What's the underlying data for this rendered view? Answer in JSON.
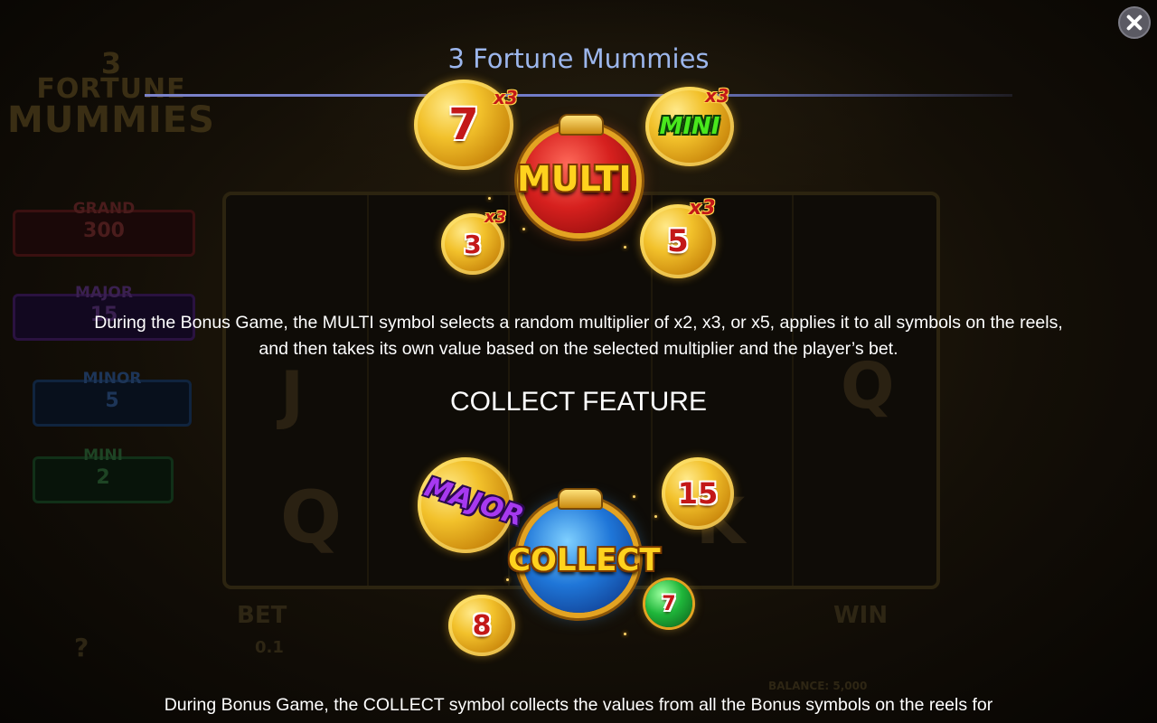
{
  "window": {
    "title": "3 Fortune Mummies"
  },
  "background": {
    "logo_lines": [
      "3",
      "FORTUNE",
      "MUMMIES"
    ],
    "jackpots": [
      {
        "label": "GRAND",
        "value": "300"
      },
      {
        "label": "MAJOR",
        "value": "15"
      },
      {
        "label": "MINOR",
        "value": "5"
      },
      {
        "label": "MINI",
        "value": "2"
      }
    ],
    "bet_label": "BET",
    "bet_value": "0.1",
    "win_label": "WIN",
    "balance": "BALANCE: 5,000"
  },
  "multi_section": {
    "symbol_label": "MULTI",
    "coins": [
      {
        "value": "7",
        "multiplier": "x3"
      },
      {
        "value": "MINI",
        "multiplier": "x3"
      },
      {
        "value": "3",
        "multiplier": "x3"
      },
      {
        "value": "5",
        "multiplier": "x3"
      }
    ],
    "description": "During the Bonus Game, the MULTI symbol selects a random multiplier of x2, x3, or x5, applies it to all symbols on the reels, and then takes its own value based on the selected multiplier and the player’s bet."
  },
  "collect_section": {
    "heading": "COLLECT FEATURE",
    "symbol_label": "COLLECT",
    "coins": [
      {
        "value": "MAJOR"
      },
      {
        "value": "15"
      },
      {
        "value": "8"
      },
      {
        "value": "7"
      }
    ],
    "description": "During Bonus Game, the COLLECT symbol collects the values from all the Bonus symbols on the reels for"
  },
  "colors": {
    "title": "#9cb6ec",
    "divider": "#7b82c9",
    "coin_gold": "#f2c12b",
    "multi_red": "#d6201e",
    "collect_blue": "#1f76d8",
    "label_yellow": "#ffd21e",
    "mini_green": "#49e81d",
    "major_purple": "#a739f0"
  },
  "icons": {
    "close": "close-icon"
  }
}
